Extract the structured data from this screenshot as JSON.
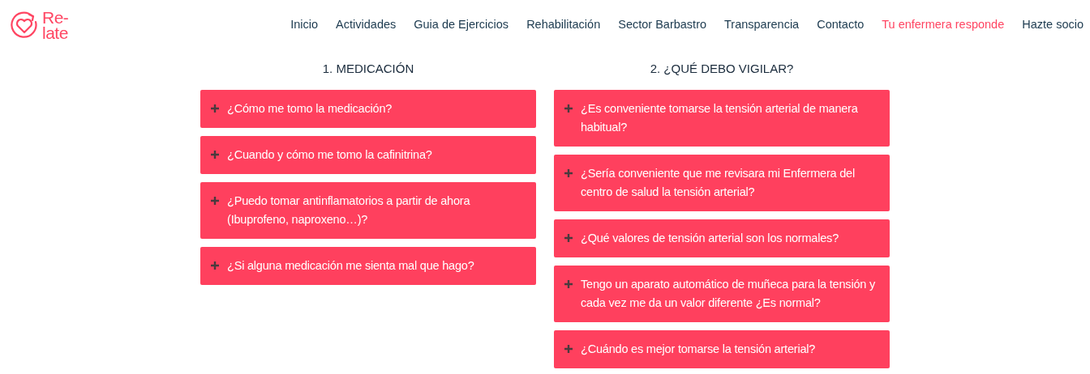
{
  "logo": {
    "text_line_1": "Re-",
    "text_line_2": "late"
  },
  "nav": [
    {
      "label": "Inicio",
      "selected": false
    },
    {
      "label": "Actividades",
      "selected": false
    },
    {
      "label": "Guia de Ejercicios",
      "selected": false
    },
    {
      "label": "Rehabilitación",
      "selected": false
    },
    {
      "label": "Sector Barbastro",
      "selected": false
    },
    {
      "label": "Transparencia",
      "selected": false
    },
    {
      "label": "Contacto",
      "selected": false
    },
    {
      "label": "Tu enfermera responde",
      "selected": true
    },
    {
      "label": "Hazte socio",
      "selected": false
    }
  ],
  "sections": [
    {
      "title": "1. MEDICACIÓN",
      "questions": [
        {
          "text": "¿Cómo me tomo la medicación?",
          "expanded": false
        },
        {
          "text": "¿Cuando y cómo me tomo la cafinitrina?",
          "expanded": false
        },
        {
          "text": "¿Puedo tomar antinflamatorios a partir de ahora (Ibuprofeno, naproxeno…)?",
          "expanded": false
        },
        {
          "text": "¿Si alguna medicación me sienta mal que hago?",
          "expanded": false
        }
      ]
    },
    {
      "title": "2. ¿QUÉ DEBO VIGILAR?",
      "questions": [
        {
          "text": "¿Es conveniente tomarse la tensión arterial de manera habitual?",
          "expanded": false
        },
        {
          "text": "¿Sería conveniente que me revisara mi Enfermera del centro de salud la tensión arterial?",
          "expanded": false
        },
        {
          "text": "¿Qué valores de tensión arterial son los normales?",
          "expanded": false
        },
        {
          "text": "Tengo un aparato automático de muñeca para la tensión y cada vez me da un valor diferente ¿Es normal?",
          "expanded": false
        },
        {
          "text": "¿Cuándo es mejor tomarse la tensión arterial?",
          "expanded": false
        }
      ]
    }
  ]
}
